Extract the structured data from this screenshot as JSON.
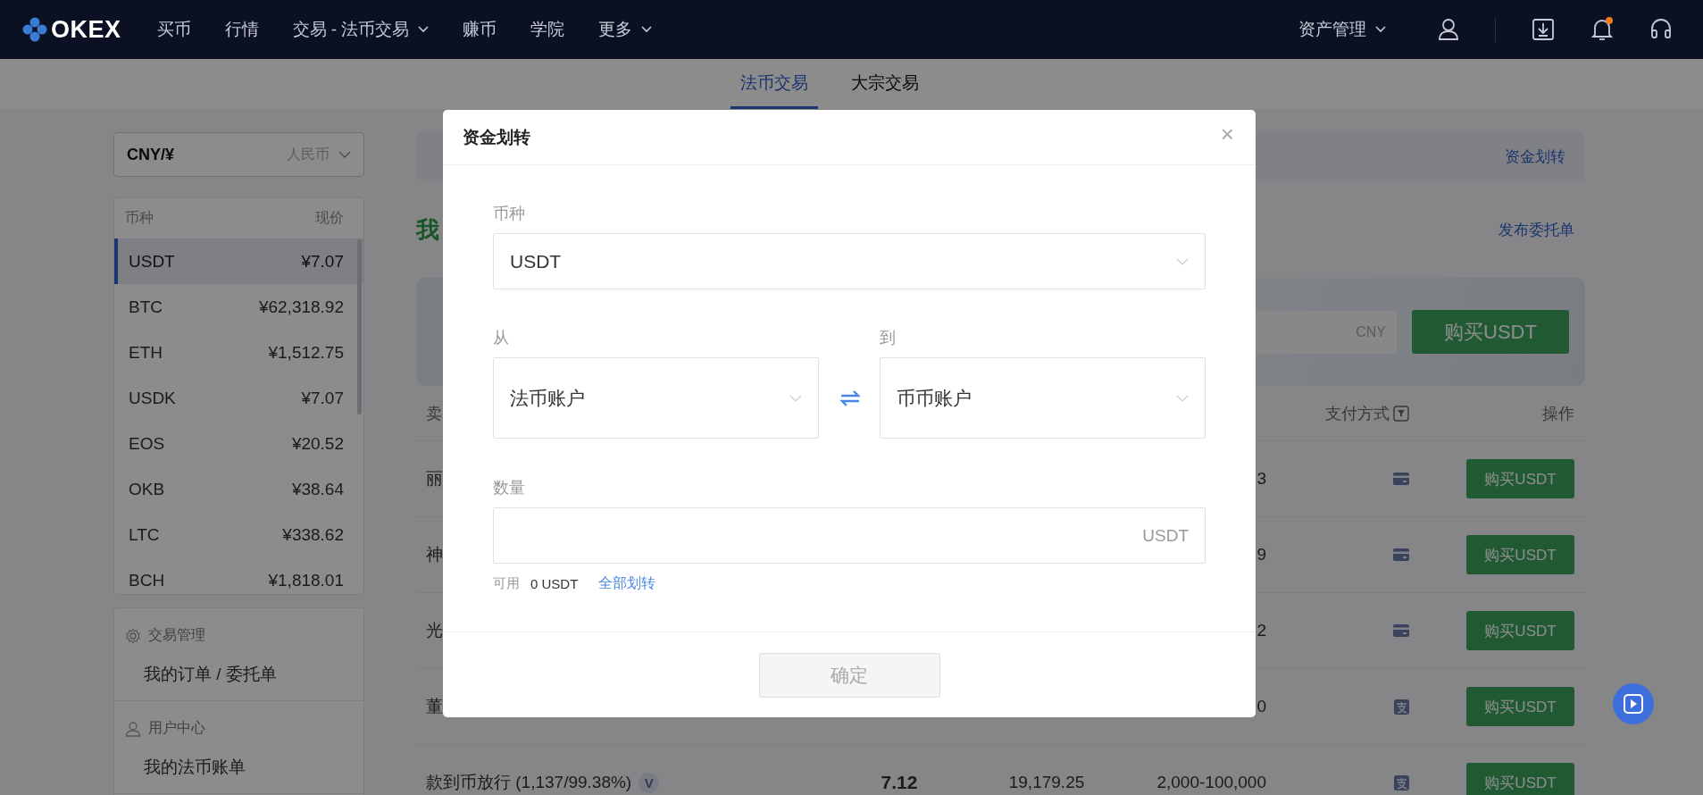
{
  "nav": {
    "logo": "OKEX",
    "items": [
      {
        "label": "买币",
        "has_caret": false
      },
      {
        "label": "行情",
        "has_caret": false
      },
      {
        "label": "交易 - 法币交易",
        "has_caret": true
      },
      {
        "label": "赚币",
        "has_caret": false
      },
      {
        "label": "学院",
        "has_caret": false
      },
      {
        "label": "更多",
        "has_caret": true
      }
    ],
    "assets": "资产管理",
    "has_notification": true
  },
  "subtabs": [
    {
      "label": "法币交易",
      "selected": true
    },
    {
      "label": "大宗交易",
      "selected": false
    }
  ],
  "sidebar": {
    "currency": {
      "value": "CNY/¥",
      "hint": "人民币"
    },
    "coin_table": {
      "columns": [
        "币种",
        "现价"
      ],
      "rows": [
        {
          "coin": "USDT",
          "price": "¥7.07",
          "selected": true
        },
        {
          "coin": "BTC",
          "price": "¥62,318.92",
          "selected": false
        },
        {
          "coin": "ETH",
          "price": "¥1,512.75",
          "selected": false
        },
        {
          "coin": "USDK",
          "price": "¥7.07",
          "selected": false
        },
        {
          "coin": "EOS",
          "price": "¥20.52",
          "selected": false
        },
        {
          "coin": "OKB",
          "price": "¥38.64",
          "selected": false
        },
        {
          "coin": "LTC",
          "price": "¥338.62",
          "selected": false
        },
        {
          "coin": "BCH",
          "price": "¥1,818.01",
          "selected": false
        }
      ]
    },
    "menu": [
      {
        "title": "交易管理",
        "kind": "gear",
        "items": [
          "我的订单 / 委托单"
        ]
      },
      {
        "title": "用户中心",
        "kind": "user",
        "items": [
          "我的法币账单"
        ]
      }
    ]
  },
  "main": {
    "banner_link": "资金划转",
    "title": "我",
    "post_link": "发布委托单",
    "quick_buy": {
      "unit": "CNY",
      "button": "购买USDT"
    },
    "table": {
      "first_header": "卖",
      "columns": [
        "支付方式",
        "操作"
      ],
      "rows": [
        {
          "name": "丽",
          "limit": "3",
          "payment": {
            "kind": "card"
          },
          "action": "购买USDT"
        },
        {
          "name": "神",
          "limit": "9",
          "payment": {
            "kind": "card"
          },
          "action": "购买USDT"
        },
        {
          "name": "光",
          "limit": "2",
          "payment": {
            "kind": "card"
          },
          "action": "购买USDT"
        },
        {
          "name": "董",
          "limit": "0",
          "payment": {
            "kind": "alipay"
          },
          "action": "购买USDT"
        },
        {
          "name": "款到币放行 (1,137/99.38%)",
          "price": "7.12",
          "quantity": "19,179.25",
          "limit": "2,000-100,000",
          "payment": {
            "kind": "alipay"
          },
          "action": "购买USDT",
          "badge": "V"
        }
      ]
    }
  },
  "modal": {
    "title": "资金划转",
    "close": "×",
    "currency_label": "币种",
    "currency_value": "USDT",
    "from_label": "从",
    "from_value": "法币账户",
    "to_label": "到",
    "to_value": "币币账户",
    "amount_label": "数量",
    "amount_unit": "USDT",
    "available_label": "可用",
    "available_value": "0 USDT",
    "transfer_all": "全部划转",
    "confirm": "确定",
    "confirm_disabled": true
  }
}
